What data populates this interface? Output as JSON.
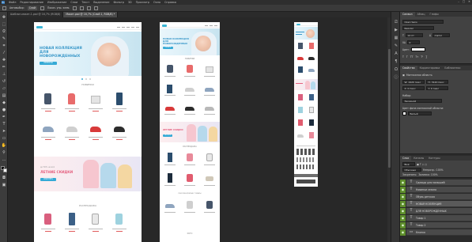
{
  "menu": {
    "logo": "Ps",
    "items": [
      "Файл",
      "Редактирование",
      "Изображение",
      "Слои",
      "Текст",
      "Выделение",
      "Фильтр",
      "3D",
      "Просмотр",
      "Окно",
      "Справка"
    ],
    "window_controls": [
      "–",
      "□",
      "✕"
    ]
  },
  "options_bar": {
    "mode_label": "Автовыбор:",
    "mode_value": "Слой",
    "transform_label": "Показ. упр. элем."
  },
  "doc_tabs": [
    {
      "label": "Шаблон-макет-1.psd @ 16,7% (RGB/8)",
      "active": false
    },
    {
      "label": "Макет.psd @ 16,7% (Слой 1, RGB/8) *",
      "active": true
    }
  ],
  "artboard_labels": [
    "Десктоп",
    "Планшет",
    "Мобильный"
  ],
  "desktop": {
    "hero_title": "НОВАЯ КОЛЛЕКЦИЯ ДЛЯ НОВОРОЖДЕННЫХ",
    "hero_cta": "ПЕРЕЙТИ",
    "section_new": "НОВИНКИ",
    "sale_title": "ЛЕТНИЕ СКИДКИ",
    "sale_subtitle": "до 50% на всё",
    "sale_cta": "СМОТРЕТЬ",
    "section_sale": "РАСПРОДАЖА"
  },
  "tablet": {
    "hero_title": "НОВАЯ КОЛЛЕКЦИЯ ДЛЯ НОВОРОЖДЕННЫХ",
    "hero_cta": "ПЕРЕЙТИ",
    "section_new": "НОВИНКИ",
    "sale_title": "ЛЕТНИЕ СКИДКИ",
    "sale_cta": "СМОТРЕТЬ",
    "section_sale": "РАСПРОДАЖА",
    "section_more": "РЕКОМЕНДУЕМЫЕ ТОВАРЫ",
    "section_last": "ФОТО"
  },
  "panel_character": {
    "tabs": [
      "Символ",
      "Абзац",
      "Глифы"
    ],
    "font_family": "Open Sans",
    "font_style": "Regular",
    "size": "14 пт",
    "leading": "(Авто)",
    "tracking": "0",
    "color_label": "Цвет:"
  },
  "panel_properties": {
    "tabs": [
      "Свойства",
      "Корректировка",
      "Библиотеки"
    ],
    "title": "Монтажная область",
    "w": "W: 1920 пикс",
    "h": "H: 3120 пикс",
    "x": "X: 0 пикс",
    "y": "Y: 0 пикс",
    "preset_label": "Набор:",
    "preset_value": "Заказной",
    "bg_label": "Цвет фона монтажной области:",
    "bg_value": "Белый"
  },
  "panel_layers": {
    "tabs": [
      "Слои",
      "Каналы",
      "Контуры"
    ],
    "filter_label": "Вид",
    "blend_mode": "Обычные",
    "opacity": "Непрозр.: 100%",
    "lock_label": "Закрепить:",
    "fill": "Заливка: 100%",
    "layers": [
      {
        "name": "Одежда для малышей",
        "type": "T",
        "selected": false
      },
      {
        "name": "Новинки сезона",
        "type": "T",
        "selected": false
      },
      {
        "name": "Обувь детская",
        "type": "T",
        "selected": false
      },
      {
        "name": "НОВАЯ КОЛЛЕКЦИЯ",
        "type": "T",
        "selected": true
      },
      {
        "name": "ДЛЯ НОВОРОЖДЕННЫХ",
        "type": "T",
        "selected": false
      },
      {
        "name": "Товар 1",
        "type": "T",
        "selected": false
      },
      {
        "name": "Товар 2",
        "type": "T",
        "selected": false
      },
      {
        "name": "Кнопка",
        "type": "▭",
        "selected": false
      }
    ]
  },
  "colors": {
    "accent_blue": "#35aad6",
    "sale_pink": "#e4607f",
    "layer_visibility_green": "#5e8e2c"
  }
}
